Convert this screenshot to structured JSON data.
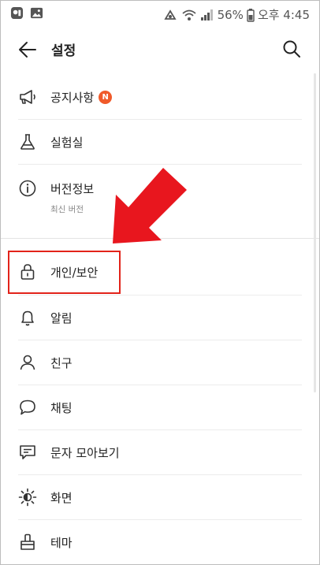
{
  "status_bar": {
    "battery_percent": "56%",
    "time": "오후 4:45"
  },
  "header": {
    "title": "설정"
  },
  "menu": {
    "notice": {
      "label": "공지사항",
      "badge": "N"
    },
    "lab": {
      "label": "실험실"
    },
    "version": {
      "label": "버전정보",
      "sub": "최신 버전"
    },
    "privacy": {
      "label": "개인/보안"
    },
    "notifications": {
      "label": "알림"
    },
    "friends": {
      "label": "친구"
    },
    "chat": {
      "label": "채팅"
    },
    "sms": {
      "label": "문자 모아보기"
    },
    "display": {
      "label": "화면"
    },
    "theme": {
      "label": "테마"
    }
  },
  "colors": {
    "annotation_red": "#e2231a",
    "badge_orange": "#f05a2a"
  }
}
